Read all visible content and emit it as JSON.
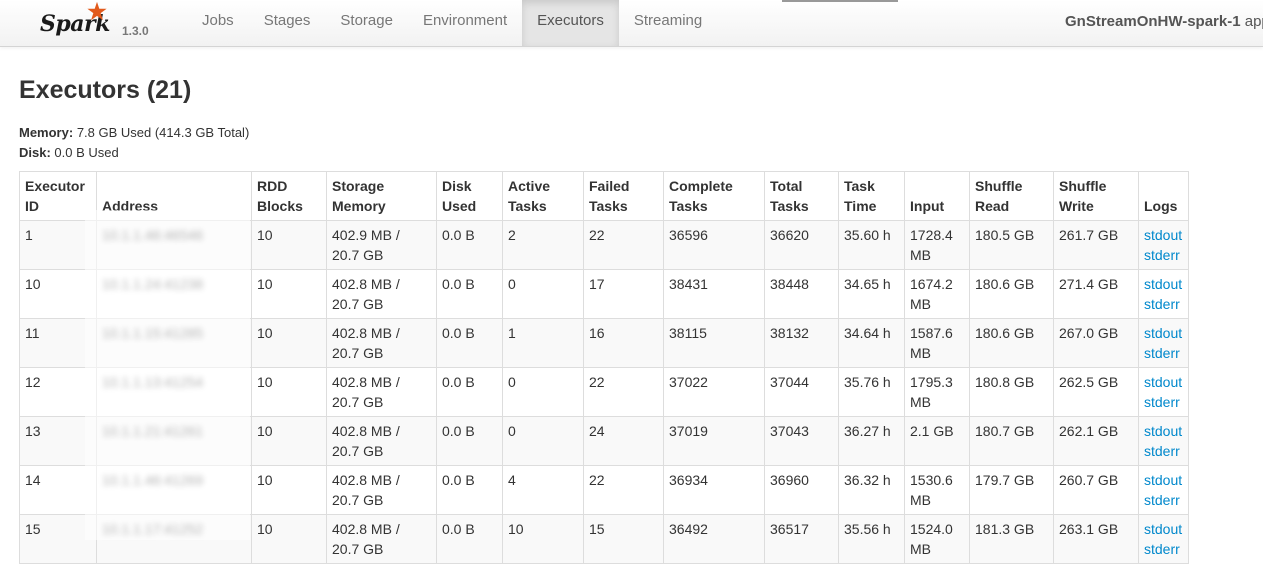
{
  "navbar": {
    "brand": "Spark",
    "version": "1.3.0",
    "tabs": [
      {
        "label": "Jobs",
        "active": false
      },
      {
        "label": "Stages",
        "active": false
      },
      {
        "label": "Storage",
        "active": false
      },
      {
        "label": "Environment",
        "active": false
      },
      {
        "label": "Executors",
        "active": true
      },
      {
        "label": "Streaming",
        "active": false
      }
    ],
    "app_name": "GnStreamOnHW-spark-1",
    "app_suffix": "app",
    "accent_color": "#e25a1c"
  },
  "page": {
    "title": "Executors (21)",
    "memory_label": "Memory:",
    "memory_value": "7.8 GB Used (414.3 GB Total)",
    "disk_label": "Disk:",
    "disk_value": "0.0 B Used"
  },
  "table": {
    "headers": [
      [
        "Executor",
        "ID"
      ],
      [
        "",
        "Address"
      ],
      [
        "RDD",
        "Blocks"
      ],
      [
        "Storage",
        "Memory"
      ],
      [
        "Disk",
        "Used"
      ],
      [
        "Active",
        "Tasks"
      ],
      [
        "Failed",
        "Tasks"
      ],
      [
        "Complete",
        "Tasks"
      ],
      [
        "Total",
        "Tasks"
      ],
      [
        "Task",
        "Time"
      ],
      [
        "",
        "Input"
      ],
      [
        "Shuffle",
        "Read"
      ],
      [
        "Shuffle",
        "Write"
      ],
      [
        "",
        "Logs"
      ]
    ],
    "rows": [
      {
        "id": "1",
        "address": "10.1.1.46:46546",
        "rdd_blocks": "10",
        "storage_memory": [
          "402.9 MB /",
          "20.7 GB"
        ],
        "disk_used": "0.0 B",
        "active_tasks": "2",
        "failed_tasks": "22",
        "complete_tasks": "36596",
        "total_tasks": "36620",
        "task_time": "35.60 h",
        "input": [
          "1728.4",
          "MB"
        ],
        "shuffle_read": "180.5 GB",
        "shuffle_write": "261.7 GB",
        "logs": [
          "stdout",
          "stderr"
        ]
      },
      {
        "id": "10",
        "address": "10.1.1.24:41238",
        "rdd_blocks": "10",
        "storage_memory": [
          "402.8 MB /",
          "20.7 GB"
        ],
        "disk_used": "0.0 B",
        "active_tasks": "0",
        "failed_tasks": "17",
        "complete_tasks": "38431",
        "total_tasks": "38448",
        "task_time": "34.65 h",
        "input": [
          "1674.2",
          "MB"
        ],
        "shuffle_read": "180.6 GB",
        "shuffle_write": "271.4 GB",
        "logs": [
          "stdout",
          "stderr"
        ]
      },
      {
        "id": "11",
        "address": "10.1.1.15:41285",
        "rdd_blocks": "10",
        "storage_memory": [
          "402.8 MB /",
          "20.7 GB"
        ],
        "disk_used": "0.0 B",
        "active_tasks": "1",
        "failed_tasks": "16",
        "complete_tasks": "38115",
        "total_tasks": "38132",
        "task_time": "34.64 h",
        "input": [
          "1587.6",
          "MB"
        ],
        "shuffle_read": "180.6 GB",
        "shuffle_write": "267.0 GB",
        "logs": [
          "stdout",
          "stderr"
        ]
      },
      {
        "id": "12",
        "address": "10.1.1.13:41254",
        "rdd_blocks": "10",
        "storage_memory": [
          "402.8 MB /",
          "20.7 GB"
        ],
        "disk_used": "0.0 B",
        "active_tasks": "0",
        "failed_tasks": "22",
        "complete_tasks": "37022",
        "total_tasks": "37044",
        "task_time": "35.76 h",
        "input": [
          "1795.3",
          "MB"
        ],
        "shuffle_read": "180.8 GB",
        "shuffle_write": "262.5 GB",
        "logs": [
          "stdout",
          "stderr"
        ]
      },
      {
        "id": "13",
        "address": "10.1.1.21:41261",
        "rdd_blocks": "10",
        "storage_memory": [
          "402.8 MB /",
          "20.7 GB"
        ],
        "disk_used": "0.0 B",
        "active_tasks": "0",
        "failed_tasks": "24",
        "complete_tasks": "37019",
        "total_tasks": "37043",
        "task_time": "36.27 h",
        "input": [
          "2.1 GB",
          ""
        ],
        "shuffle_read": "180.7 GB",
        "shuffle_write": "262.1 GB",
        "logs": [
          "stdout",
          "stderr"
        ]
      },
      {
        "id": "14",
        "address": "10.1.1.46:41269",
        "rdd_blocks": "10",
        "storage_memory": [
          "402.8 MB /",
          "20.7 GB"
        ],
        "disk_used": "0.0 B",
        "active_tasks": "4",
        "failed_tasks": "22",
        "complete_tasks": "36934",
        "total_tasks": "36960",
        "task_time": "36.32 h",
        "input": [
          "1530.6",
          "MB"
        ],
        "shuffle_read": "179.7 GB",
        "shuffle_write": "260.7 GB",
        "logs": [
          "stdout",
          "stderr"
        ]
      },
      {
        "id": "15",
        "address": "10.1.1.17:41252",
        "rdd_blocks": "10",
        "storage_memory": [
          "402.8 MB /",
          "20.7 GB"
        ],
        "disk_used": "0.0 B",
        "active_tasks": "10",
        "failed_tasks": "15",
        "complete_tasks": "36492",
        "total_tasks": "36517",
        "task_time": "35.56 h",
        "input": [
          "1524.0",
          "MB"
        ],
        "shuffle_read": "181.3 GB",
        "shuffle_write": "263.1 GB",
        "logs": [
          "stdout",
          "stderr"
        ]
      }
    ]
  }
}
